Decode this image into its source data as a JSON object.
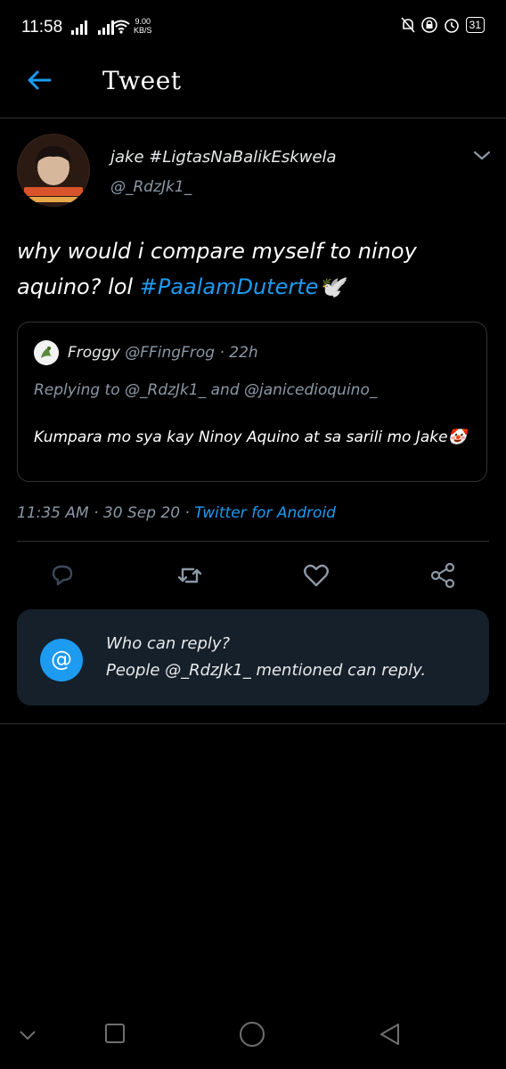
{
  "status_bar": {
    "time": "11:58",
    "speed_value": "9.00",
    "speed_unit": "KB/S",
    "battery": "31"
  },
  "header": {
    "back_icon": "arrow-left-icon",
    "title": "Tweet"
  },
  "tweet": {
    "author_name": "jake #LigtasNaBalikEskwela",
    "author_handle": "@_RdzJk1_",
    "text_plain": "why would i compare myself to ninoy aquino? lol ",
    "text_hashtag": "#PaalamDuterte",
    "text_emoji": "🕊️",
    "quote": {
      "name": "Froggy",
      "handle": "@FFingFrog",
      "separator": "·",
      "time": "22h",
      "replying_prefix": "Replying to",
      "replying_user1": "@_RdzJk1_",
      "replying_and": "and",
      "replying_user2": "@janicedioquino_",
      "text": "Kumpara mo sya kay Ninoy Aquino at sa sarili mo Jake🤡"
    },
    "meta_time": "11:35 AM",
    "meta_sep1": "·",
    "meta_date": "30 Sep 20",
    "meta_sep2": "·",
    "meta_source": "Twitter for Android"
  },
  "actions": [
    "reply-icon",
    "retweet-icon",
    "like-icon",
    "share-icon"
  ],
  "who_can_reply": {
    "icon_glyph": "@",
    "title": "Who can reply?",
    "subtitle": "People @_RdzJk1_ mentioned can reply."
  },
  "colors": {
    "background": "#000000",
    "accent": "#1d9bf0",
    "muted": "#8b98a5",
    "card": "#15202b"
  }
}
